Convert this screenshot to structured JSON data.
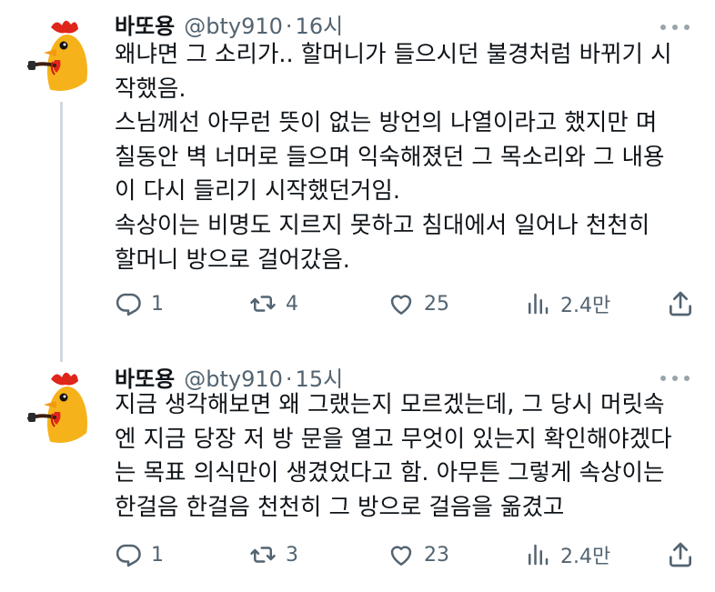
{
  "tweets": [
    {
      "author_name": "바또용",
      "handle": "@bty910",
      "separator": "·",
      "time": "16시",
      "lines": [
        "왜냐면 그 소리가.. 할머니가 들으시던 불경처럼 바뀌기 시",
        "작했음.",
        "스님께선 아무런 뜻이 없는 방언의 나열이라고 했지만 며",
        "칠동안 벽 너머로 들으며 익숙해졌던 그 목소리와 그 내용",
        "이 다시 들리기 시작했던거임.",
        "속상이는 비명도 지르지 못하고 침대에서 일어나 천천히",
        "할머니 방으로 걸어갔음."
      ],
      "replies": "1",
      "retweets": "4",
      "likes": "25",
      "views": "2.4만"
    },
    {
      "author_name": "바또용",
      "handle": "@bty910",
      "separator": "·",
      "time": "15시",
      "lines": [
        "지금 생각해보면 왜 그랬는지 모르겠는데, 그 당시 머릿속",
        "엔 지금 당장 저 방 문을 열고 무엇이 있는지 확인해야겠다",
        "는 목표 의식만이 생겼었다고 함. 아무튼 그렇게 속상이는",
        "한걸음 한걸음 천천히 그 방으로 걸음을 옮겼고"
      ],
      "replies": "1",
      "retweets": "3",
      "likes": "23",
      "views": "2.4만"
    }
  ],
  "icons": {
    "avatar": "rooster-avatar",
    "more": "more-icon",
    "reply": "reply-icon",
    "retweet": "retweet-icon",
    "like": "heart-icon",
    "views": "views-icon",
    "share": "share-icon"
  },
  "colors": {
    "text": "#0f1419",
    "secondary": "#536471",
    "thread_line": "#cfd9de",
    "more_dots": "#9aa4ab"
  }
}
